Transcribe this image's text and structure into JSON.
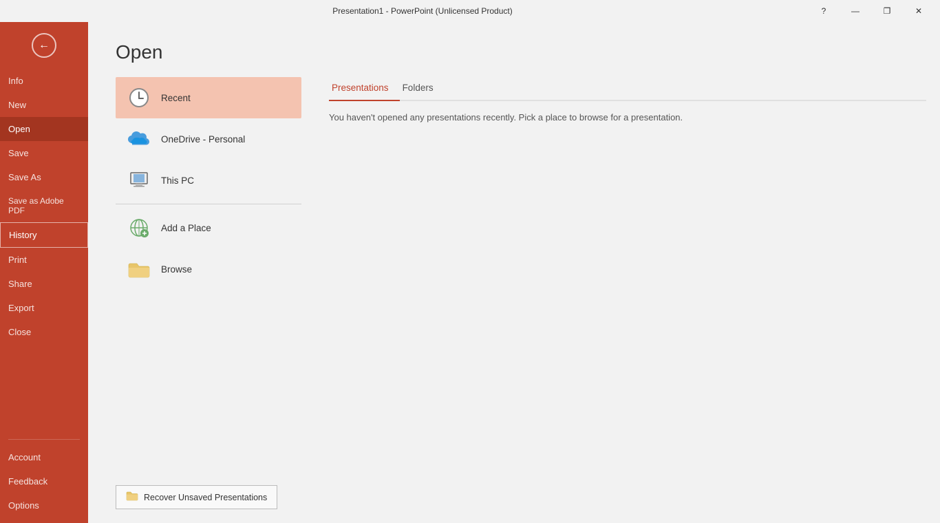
{
  "titlebar": {
    "title": "Presentation1  -  PowerPoint (Unlicensed Product)",
    "help_label": "?",
    "minimize_label": "—",
    "maximize_label": "❐",
    "close_label": "✕"
  },
  "sidebar": {
    "back_icon": "←",
    "items": [
      {
        "id": "info",
        "label": "Info"
      },
      {
        "id": "new",
        "label": "New"
      },
      {
        "id": "open",
        "label": "Open",
        "active": true
      },
      {
        "id": "save",
        "label": "Save"
      },
      {
        "id": "save-as",
        "label": "Save As"
      },
      {
        "id": "save-as-pdf",
        "label": "Save as Adobe PDF"
      },
      {
        "id": "history",
        "label": "History",
        "highlighted": true
      },
      {
        "id": "print",
        "label": "Print"
      },
      {
        "id": "share",
        "label": "Share"
      },
      {
        "id": "export",
        "label": "Export"
      },
      {
        "id": "close",
        "label": "Close"
      }
    ],
    "bottom_items": [
      {
        "id": "account",
        "label": "Account"
      },
      {
        "id": "feedback",
        "label": "Feedback"
      },
      {
        "id": "options",
        "label": "Options"
      }
    ]
  },
  "page": {
    "title": "Open"
  },
  "locations": [
    {
      "id": "recent",
      "label": "Recent",
      "icon": "🕐",
      "active": true,
      "icon_type": "clock"
    },
    {
      "id": "onedrive",
      "label": "OneDrive - Personal",
      "icon": "☁",
      "icon_type": "cloud"
    },
    {
      "id": "this-pc",
      "label": "This PC",
      "icon": "🖥",
      "icon_type": "pc"
    },
    {
      "id": "add-place",
      "label": "Add a Place",
      "icon": "🌐",
      "icon_type": "globe"
    },
    {
      "id": "browse",
      "label": "Browse",
      "icon": "📁",
      "icon_type": "folder"
    }
  ],
  "tabs": [
    {
      "id": "presentations",
      "label": "Presentations",
      "active": true
    },
    {
      "id": "folders",
      "label": "Folders",
      "active": false
    }
  ],
  "recent": {
    "empty_message": "You haven't opened any presentations recently. Pick a place to browse for a presentation."
  },
  "recover": {
    "label": "Recover Unsaved Presentations",
    "icon": "📁"
  }
}
